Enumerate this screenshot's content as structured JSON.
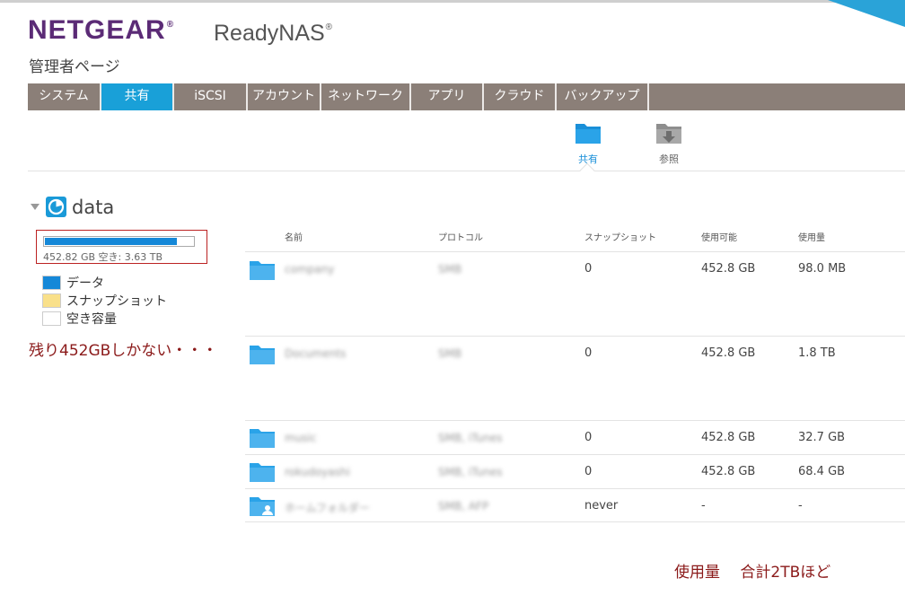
{
  "brand": {
    "logo": "NETGEAR",
    "product": "ReadyNAS",
    "registered": "®",
    "subtitle": "管理者ページ"
  },
  "nav": {
    "tabs": [
      {
        "label": "システム",
        "active": false
      },
      {
        "label": "共有",
        "active": true
      },
      {
        "label": "iSCSI",
        "active": false
      },
      {
        "label": "アカウント",
        "active": false
      },
      {
        "label": "ネットワーク",
        "active": false
      },
      {
        "label": "アプリ",
        "active": false
      },
      {
        "label": "クラウド",
        "active": false
      },
      {
        "label": "バックアップ",
        "active": false
      }
    ]
  },
  "subnav": {
    "shares": {
      "label": "共有",
      "icon": "folder-icon"
    },
    "browse": {
      "label": "参照",
      "icon": "browse-folder-icon"
    }
  },
  "volume": {
    "name": "data",
    "usage_text": "452.82 GB 空き: 3.63 TB",
    "used_fraction": 0.89,
    "legend": [
      {
        "label": "データ",
        "color": "#1588d8"
      },
      {
        "label": "スナップショット",
        "color": "#f9e08a"
      },
      {
        "label": "空き容量",
        "color": "#ffffff"
      }
    ]
  },
  "annotations": {
    "remaining": "残り452GBしかない・・・",
    "total": "使用量　 合計2TBほど"
  },
  "table": {
    "headers": {
      "name": "名前",
      "protocol": "プロトコル",
      "snapshot": "スナップショット",
      "available": "使用可能",
      "used": "使用量"
    },
    "rows": [
      {
        "name": "company",
        "protocol": "SMB",
        "snapshot": "0",
        "available": "452.8 GB",
        "used": "98.0 MB"
      },
      {
        "name": "Documents",
        "protocol": "SMB",
        "snapshot": "0",
        "available": "452.8 GB",
        "used": "1.8 TB"
      },
      {
        "name": "music",
        "protocol": "SMB, iTunes",
        "snapshot": "0",
        "available": "452.8 GB",
        "used": "32.7 GB"
      },
      {
        "name": "rokudoyashi",
        "protocol": "SMB, iTunes",
        "snapshot": "0",
        "available": "452.8 GB",
        "used": "68.4 GB"
      },
      {
        "name": "ホームフォルダー",
        "protocol": "SMB, AFP",
        "snapshot": "never",
        "available": "-",
        "used": "-"
      }
    ]
  },
  "colors": {
    "accent": "#19a0d8",
    "brand": "#5b2b76",
    "nav_bg": "#8b7f78",
    "annotation": "#8b1a1a"
  }
}
